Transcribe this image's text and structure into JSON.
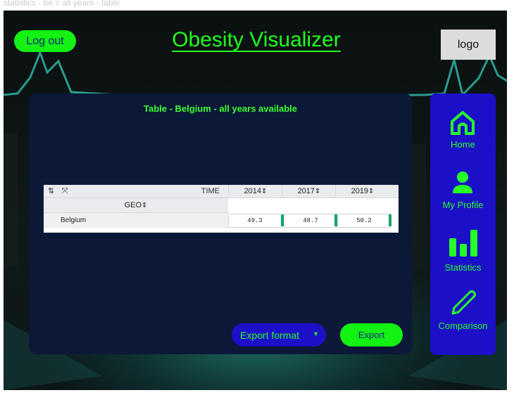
{
  "page": {
    "caption": "statistics - be = all years - table"
  },
  "header": {
    "logout_label": "Log out",
    "title": "Obesity Visualizer",
    "logo_label": "logo"
  },
  "panel": {
    "title": "Table - Belgium - all years available",
    "table": {
      "time_label": "TIME",
      "geo_label": "GEO",
      "sort_glyph": "⇕",
      "years": [
        "2014",
        "2017",
        "2019"
      ],
      "rows": [
        {
          "label": "Belgium",
          "values": [
            "49.3",
            "48.7",
            "50.2"
          ]
        }
      ]
    },
    "export_format_label": "Export format",
    "export_label": "Export"
  },
  "sidebar": {
    "items": [
      {
        "label": "Home",
        "icon": "home-icon"
      },
      {
        "label": "My Profile",
        "icon": "user-icon"
      },
      {
        "label": "Statistics",
        "icon": "bar-chart-icon"
      },
      {
        "label": "Comparison",
        "icon": "pencil-icon"
      }
    ]
  },
  "colors": {
    "accent_green": "#13f213",
    "panel_navy": "#0c1838",
    "sidebar_blue": "#1b10c8",
    "table_bar_green": "#12a56d"
  }
}
